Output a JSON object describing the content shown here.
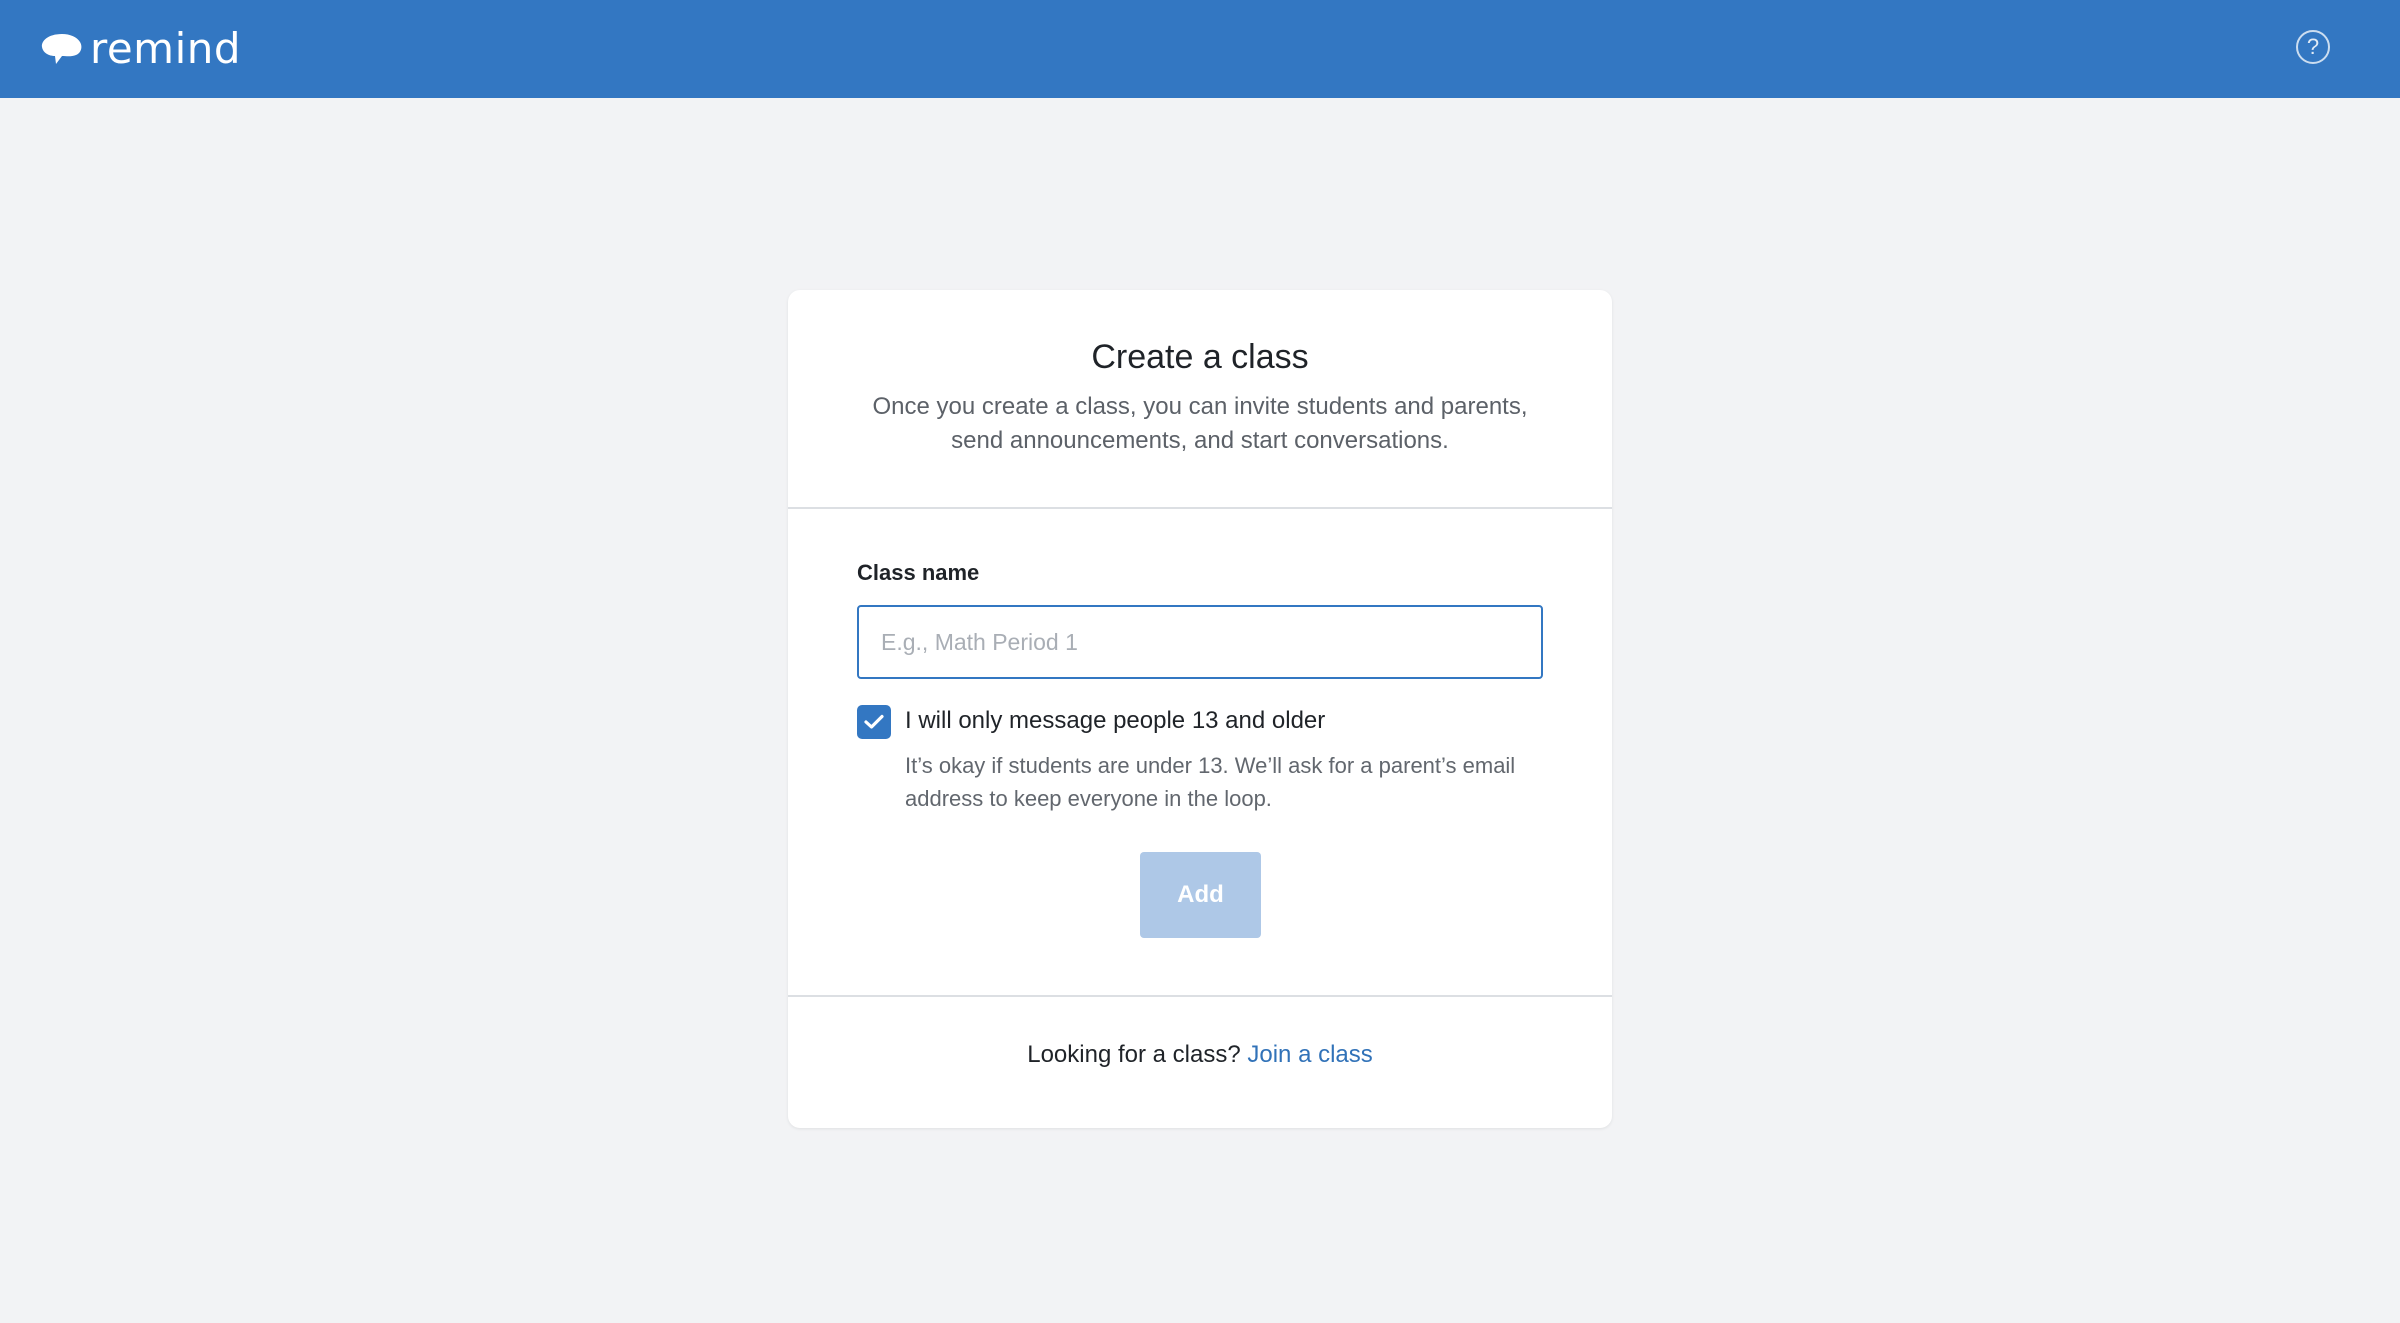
{
  "header": {
    "brand_name": "remind",
    "logo_icon": "brain-cloud-icon",
    "help_icon": "question-circle-icon",
    "help_symbol": "?",
    "bar_color": "#3377c2"
  },
  "create_class": {
    "title": "Create a class",
    "description": "Once you create a class, you can invite students and parents, send announcements, and start conversations.",
    "class_name_label": "Class name",
    "class_name_value": "",
    "class_name_placeholder": "E.g., Math Period 1",
    "age_checkbox_checked": true,
    "age_checkbox_label": "I will only message people 13 and older",
    "age_checkbox_help": "It’s okay if students are under 13. We’ll ask for a parent’s email address to keep everyone in the loop.",
    "add_button_label": "Add",
    "add_button_disabled": true
  },
  "footer": {
    "prompt": "Looking for a class?",
    "join_link_label": "Join a class",
    "link_color": "#3172b8"
  }
}
